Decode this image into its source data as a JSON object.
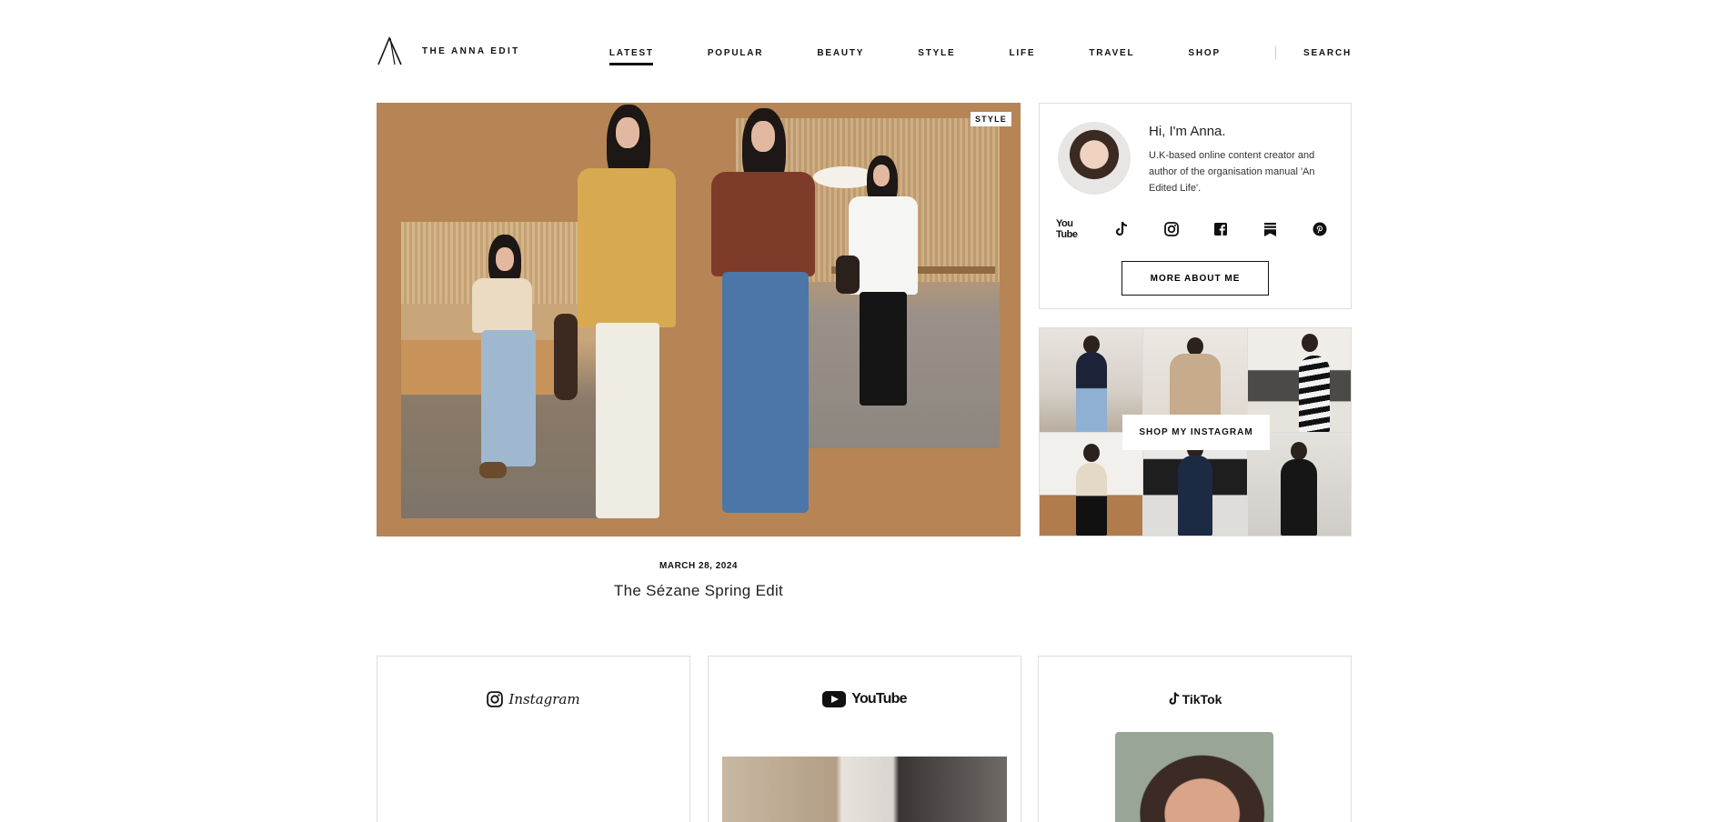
{
  "brand": {
    "name": "THE ANNA EDIT"
  },
  "nav": {
    "items": [
      {
        "label": "LATEST",
        "active": true
      },
      {
        "label": "POPULAR"
      },
      {
        "label": "BEAUTY"
      },
      {
        "label": "STYLE"
      },
      {
        "label": "LIFE"
      },
      {
        "label": "TRAVEL"
      },
      {
        "label": "SHOP"
      }
    ],
    "search": "SEARCH"
  },
  "hero": {
    "category": "STYLE",
    "date": "MARCH 28, 2024",
    "title": "The Sézane Spring Edit",
    "background": "#b68455"
  },
  "about": {
    "title": "Hi, I'm Anna.",
    "text": "U.K-based online content creator and author of the organisation manual 'An Edited Life'.",
    "socials": [
      "youtube-icon",
      "tiktok-icon",
      "instagram-icon",
      "facebook-icon",
      "substack-icon",
      "pinterest-icon"
    ],
    "youtube_label": "You Tube",
    "button": "MORE ABOUT ME"
  },
  "instagram_grid": {
    "button": "SHOP MY INSTAGRAM"
  },
  "cards": {
    "instagram": "Instagram",
    "youtube": "YouTube",
    "tiktok": "TikTok"
  }
}
